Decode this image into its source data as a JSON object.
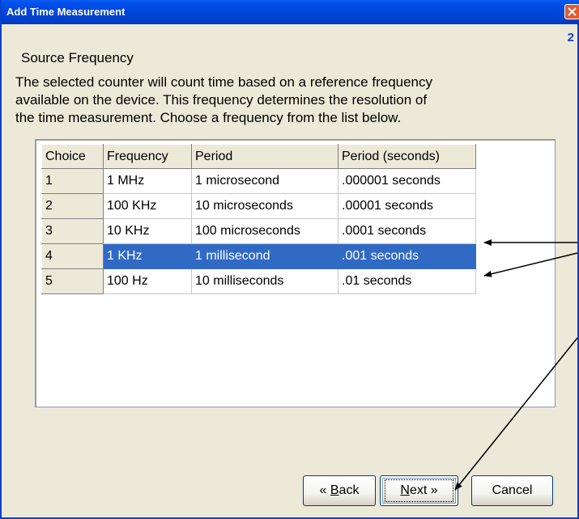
{
  "window": {
    "title": "Add Time Measurement",
    "step": "2"
  },
  "heading": "Source Frequency",
  "description_lines": [
    "The selected counter will count time based on a reference frequency",
    "available on the device.  This frequency determines the resolution of",
    "the time measurement.  Choose a frequency from the list below."
  ],
  "table": {
    "headers": [
      "Choice",
      "Frequency",
      "Period",
      "Period (seconds)"
    ],
    "rows": [
      [
        "1",
        "1 MHz",
        "1 microsecond",
        ".000001 seconds"
      ],
      [
        "2",
        "100 KHz",
        "10 microseconds",
        ".00001 seconds"
      ],
      [
        "3",
        "10 KHz",
        "100 microseconds",
        ".0001 seconds"
      ],
      [
        "4",
        "1 KHz",
        "1 millisecond",
        ".001 seconds"
      ],
      [
        "5",
        "100 Hz",
        "10 milliseconds",
        ".01 seconds"
      ]
    ],
    "selected_row": "4"
  },
  "buttons": {
    "back": {
      "prefix": "« ",
      "mnemonic": "B",
      "rest": "ack"
    },
    "next": {
      "mnemonic": "N",
      "rest": "ext",
      "suffix": " »"
    },
    "cancel": "Cancel"
  },
  "colors": {
    "titlebar": "#0046d8",
    "selection": "#316ac5",
    "face": "#ece9d8",
    "close": "#e25b2f"
  },
  "icons": [
    "close-icon"
  ]
}
